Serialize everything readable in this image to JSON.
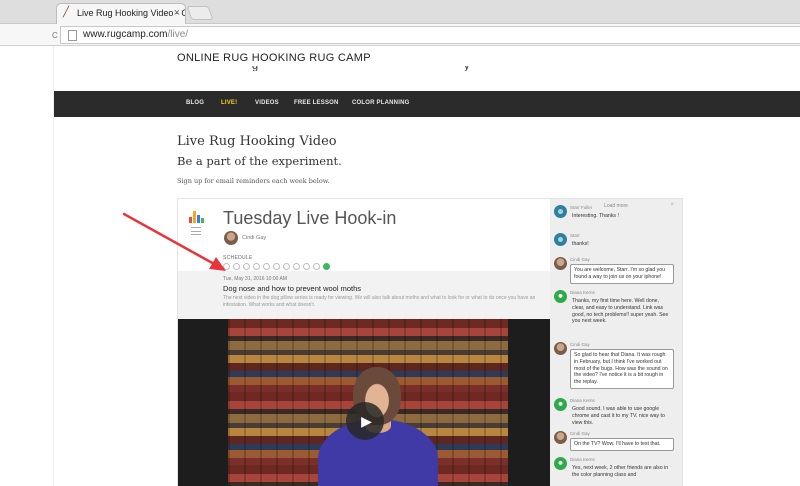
{
  "browser": {
    "tab_title": "Live Rug Hooking Video - C",
    "tab_close": "×",
    "url_host": "www.rugcamp.com",
    "url_path": "/live/"
  },
  "site": {
    "title": "ONLINE RUG HOOKING RUG CAMP",
    "nav": [
      {
        "label": "BLOG"
      },
      {
        "label": "LIVE!",
        "active": true
      },
      {
        "label": "VIDEOS"
      },
      {
        "label": "FREE LESSON"
      },
      {
        "label": "COLOR PLANNING"
      }
    ],
    "active_color": "#f2d31b"
  },
  "intro": {
    "heading": "Live Rug Hooking Video",
    "subheading": "Be a part of the experiment.",
    "signup": "Sign up for email reminders each week below."
  },
  "event": {
    "title": "Tuesday Live Hook-in",
    "host": "Cindi Gay",
    "schedule_label": "SCHEDULE",
    "schedule_dots": [
      0,
      0,
      0,
      0,
      0,
      0,
      0,
      0,
      0,
      0,
      1
    ],
    "date": "Tue, May 31, 2016 10:00 AM",
    "heading": "Dog nose and how to prevent wool moths",
    "description": "The next video in the dog pillow series is ready for viewing. We will also talk about moths and what to look for or what to do once you have an infestation. What works and what doesn't.",
    "play_icon": "▶"
  },
  "chat": {
    "load_more": "Load more",
    "close": "×",
    "messages": [
      {
        "author": "Starr Fuller",
        "text": "Interesting. Thanks !",
        "avatar": "starr",
        "mine": false
      },
      {
        "author": "Starr",
        "text": "thanks!",
        "avatar": "starr",
        "mine": false
      },
      {
        "author": "Cindi Gay",
        "text": "You are welcome, Starr. I'm so glad you found a way to join us on your iphone!",
        "avatar": "cindi",
        "mine": true
      },
      {
        "author": "Diana Kerns",
        "text": "Thanks, my first time here. Well done, clear, and easy to understand. Link was good, no tech problems!! super yeah. See you next week.",
        "avatar": "green",
        "mine": false
      },
      {
        "author": "Cindi Gay",
        "text": "So glad to hear that Diana. It was rough in February, but I think I've worked out most of the bugs. How was the sound on the video? I've notice it is a bit rough in the replay.",
        "avatar": "cindi",
        "mine": true
      },
      {
        "author": "Diana Kerns",
        "text": "Good sound. I was able to use google chrome and cast it to my TV. nice way to view this.",
        "avatar": "green",
        "mine": false
      },
      {
        "author": "Cindi Gay",
        "text": "On the TV? Wow. I'll have to test that.",
        "avatar": "cindi",
        "mine": true
      },
      {
        "author": "Diana Kerns",
        "text": "Yes, next week, 2 other friends are also in the color planning class and",
        "avatar": "green",
        "mine": false
      }
    ]
  },
  "colors": {
    "nav_bg": "#2b2b2b",
    "annotation_arrow": "#e8343a",
    "online_dot": "#3cb95a"
  }
}
